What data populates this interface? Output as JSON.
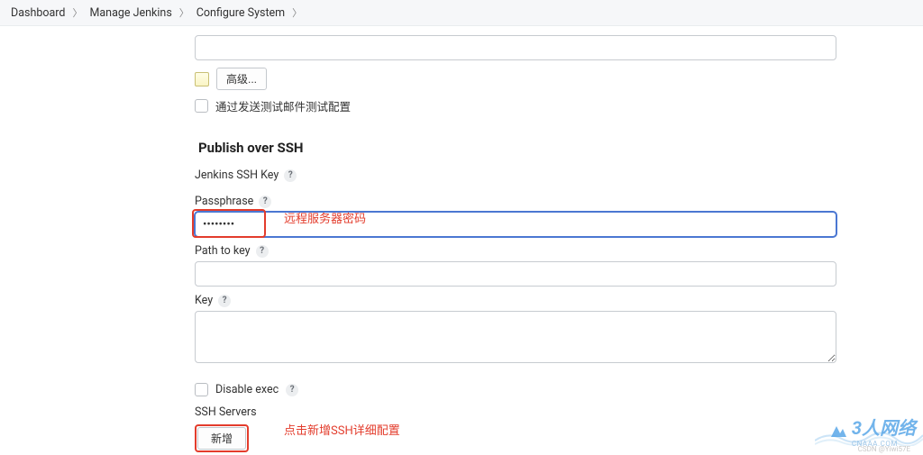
{
  "breadcrumb": {
    "items": [
      "Dashboard",
      "Manage Jenkins",
      "Configure System"
    ]
  },
  "top_input": {
    "value": ""
  },
  "advanced_button": "高级...",
  "test_email_checkbox": {
    "label": "通过发送测试邮件测试配置"
  },
  "section": {
    "title": "Publish over SSH",
    "ssh_key_label": "Jenkins SSH Key",
    "passphrase": {
      "label": "Passphrase",
      "value": "••••••••"
    },
    "path_to_key": {
      "label": "Path to key",
      "value": ""
    },
    "key": {
      "label": "Key",
      "value": ""
    },
    "disable_exec": {
      "label": "Disable exec"
    },
    "ssh_servers": {
      "label": "SSH Servers",
      "add_button": "新增"
    }
  },
  "annotations": {
    "passphrase": "远程服务器密码",
    "add_server": "点击新增SSH详细配置"
  },
  "watermark": {
    "main": "3人网络",
    "sub": "CNAAA.COM",
    "credit": "CSDN @Yiwi57E"
  }
}
